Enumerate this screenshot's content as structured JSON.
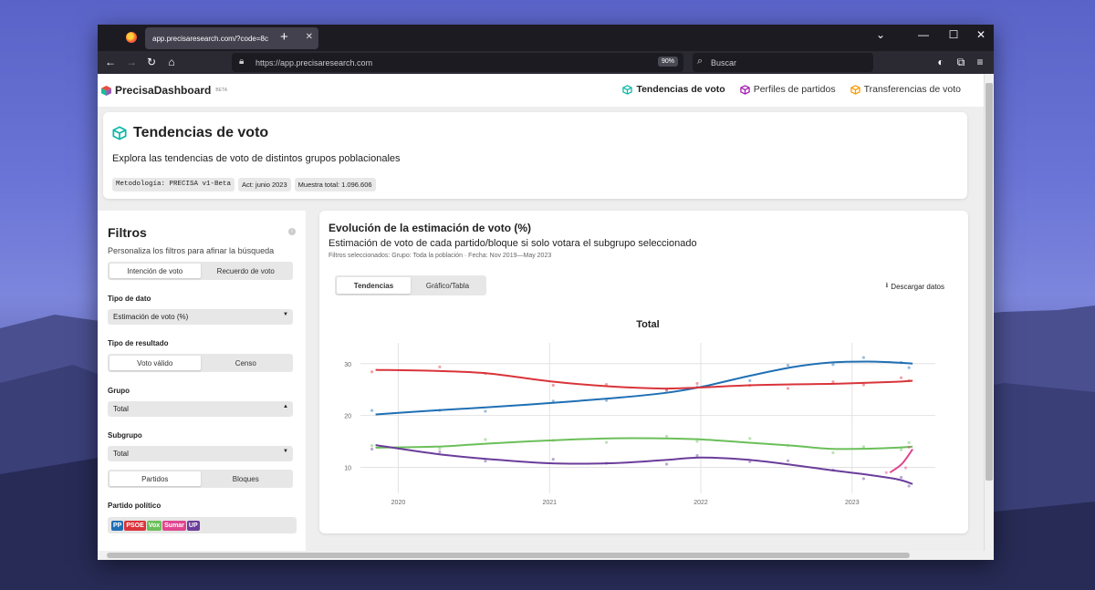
{
  "browser": {
    "tab_title": "app.precisaresearch.com/?code=8c",
    "url": "https://app.precisaresearch.com",
    "zoom": "90%",
    "search_placeholder": "Buscar"
  },
  "nav": {
    "brand": "PrecisaDashboard",
    "beta": "BETA",
    "links": [
      {
        "label": "Tendencias de voto",
        "active": true,
        "color": "#14b8a6"
      },
      {
        "label": "Perfiles de partidos",
        "active": false,
        "color": "#a21caf"
      },
      {
        "label": "Transferencias de voto",
        "active": false,
        "color": "#f59e0b"
      }
    ]
  },
  "header": {
    "title": "Tendencias de voto",
    "subtitle": "Explora las tendencias de voto de distintos grupos poblacionales",
    "badges": [
      "Metodología: PRECISA v1-Beta",
      "Act: junio 2023",
      "Muestra total: 1.096.606"
    ]
  },
  "filters": {
    "title": "Filtros",
    "subtitle": "Personaliza los filtros para afinar la búsqueda",
    "mode_tabs": [
      "Intención de voto",
      "Recuerdo de voto"
    ],
    "data_type_label": "Tipo de dato",
    "data_type_value": "Estimación de voto (%)",
    "result_type_label": "Tipo de resultado",
    "result_tabs": [
      "Voto válido",
      "Censo"
    ],
    "group_label": "Grupo",
    "group_value": "Total",
    "subgroup_label": "Subgrupo",
    "subgroup_value": "Total",
    "party_tabs": [
      "Partidos",
      "Bloques"
    ],
    "party_label": "Partido político",
    "parties": [
      {
        "name": "PP",
        "color": "#1f6fb4"
      },
      {
        "name": "PSOE",
        "color": "#d9343a"
      },
      {
        "name": "Vox",
        "color": "#6bbf59"
      },
      {
        "name": "Sumar",
        "color": "#e0468f"
      },
      {
        "name": "UP",
        "color": "#6a3d9a"
      }
    ]
  },
  "chart_card": {
    "title": "Evolución de la estimación de voto (%)",
    "subtitle": "Estimación de voto de cada partido/bloque si solo votara el subgrupo seleccionado",
    "filters_text": "Filtros seleccionados: Grupo: Toda la población · Fecha: Nov 2019—May 2023",
    "tabs": [
      "Tendencias",
      "Gráfico/Tabla"
    ],
    "download": "Descargar datos"
  },
  "chart_data": {
    "type": "line",
    "title": "Total",
    "xlabel": "",
    "ylabel": "",
    "x_ticks": [
      "2020",
      "2021",
      "2022",
      "2023"
    ],
    "y_ticks": [
      10,
      20,
      30
    ],
    "ylim": [
      5,
      34
    ],
    "x": [
      2019.85,
      2020.25,
      2020.6,
      2021.0,
      2021.4,
      2021.75,
      2022.0,
      2022.3,
      2022.6,
      2022.85,
      2023.1,
      2023.3,
      2023.4
    ],
    "series": [
      {
        "name": "PP",
        "color": "#1f6fb4",
        "values": [
          20.2,
          21.0,
          21.6,
          22.4,
          23.3,
          24.3,
          25.5,
          27.5,
          29.3,
          30.2,
          30.4,
          30.2,
          30.0
        ]
      },
      {
        "name": "PSOE",
        "color": "#d9343a",
        "values": [
          28.8,
          28.6,
          28.1,
          26.6,
          25.6,
          25.2,
          25.4,
          25.8,
          26.0,
          26.1,
          26.3,
          26.5,
          26.7
        ]
      },
      {
        "name": "Vox",
        "color": "#6bbf59",
        "values": [
          13.8,
          14.0,
          14.6,
          15.2,
          15.6,
          15.6,
          15.4,
          14.8,
          14.2,
          13.6,
          13.6,
          13.8,
          14.0
        ]
      },
      {
        "name": "UP",
        "color": "#6a3d9a",
        "values": [
          14.3,
          12.6,
          11.6,
          10.8,
          10.8,
          11.4,
          11.9,
          11.5,
          10.5,
          9.5,
          8.6,
          7.7,
          6.8
        ]
      },
      {
        "name": "Sumar",
        "color": "#e0468f",
        "x": [
          2023.25,
          2023.33,
          2023.4
        ],
        "values": [
          9.0,
          10.7,
          13.5
        ]
      }
    ],
    "grid": true
  }
}
